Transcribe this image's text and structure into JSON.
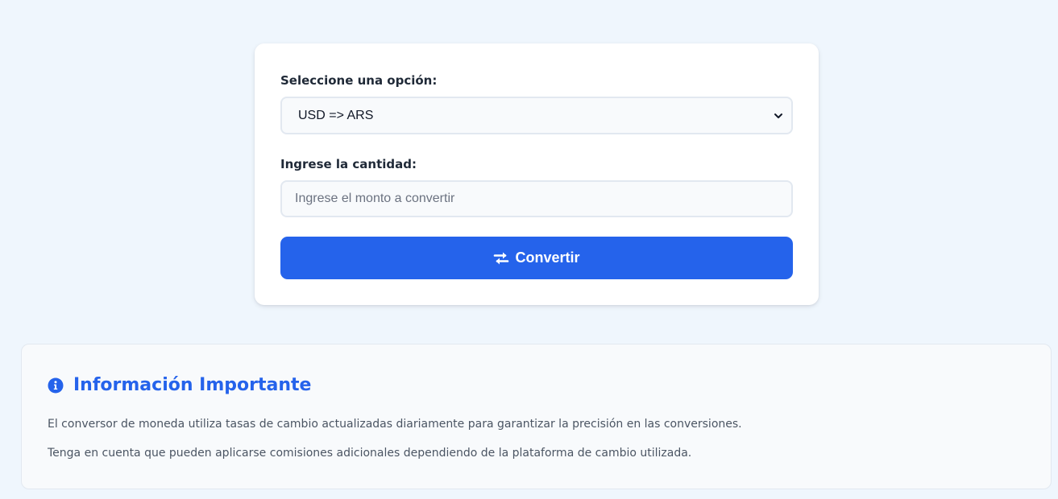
{
  "converter": {
    "select_label": "Seleccione una opción:",
    "selected_option": "USD => ARS",
    "amount_label": "Ingrese la cantidad:",
    "amount_placeholder": "Ingrese el monto a convertir",
    "amount_value": "",
    "convert_button_label": "Convertir",
    "convert_icon": "exchange-arrows-icon"
  },
  "info": {
    "title": "Información Importante",
    "icon": "info-circle-icon",
    "paragraphs": [
      "El conversor de moneda utiliza tasas de cambio actualizadas diariamente para garantizar la precisión en las conversiones.",
      "Tenga en cuenta que pueden aplicarse comisiones adicionales dependiendo de la plataforma de cambio utilizada."
    ]
  },
  "colors": {
    "page_background": "#eff6fd",
    "accent": "#2563eb",
    "card_background": "#ffffff",
    "field_border": "#e2e8f0",
    "field_background": "#f8fafc",
    "text_dark": "#1f2937",
    "text_muted": "#4b5563"
  }
}
